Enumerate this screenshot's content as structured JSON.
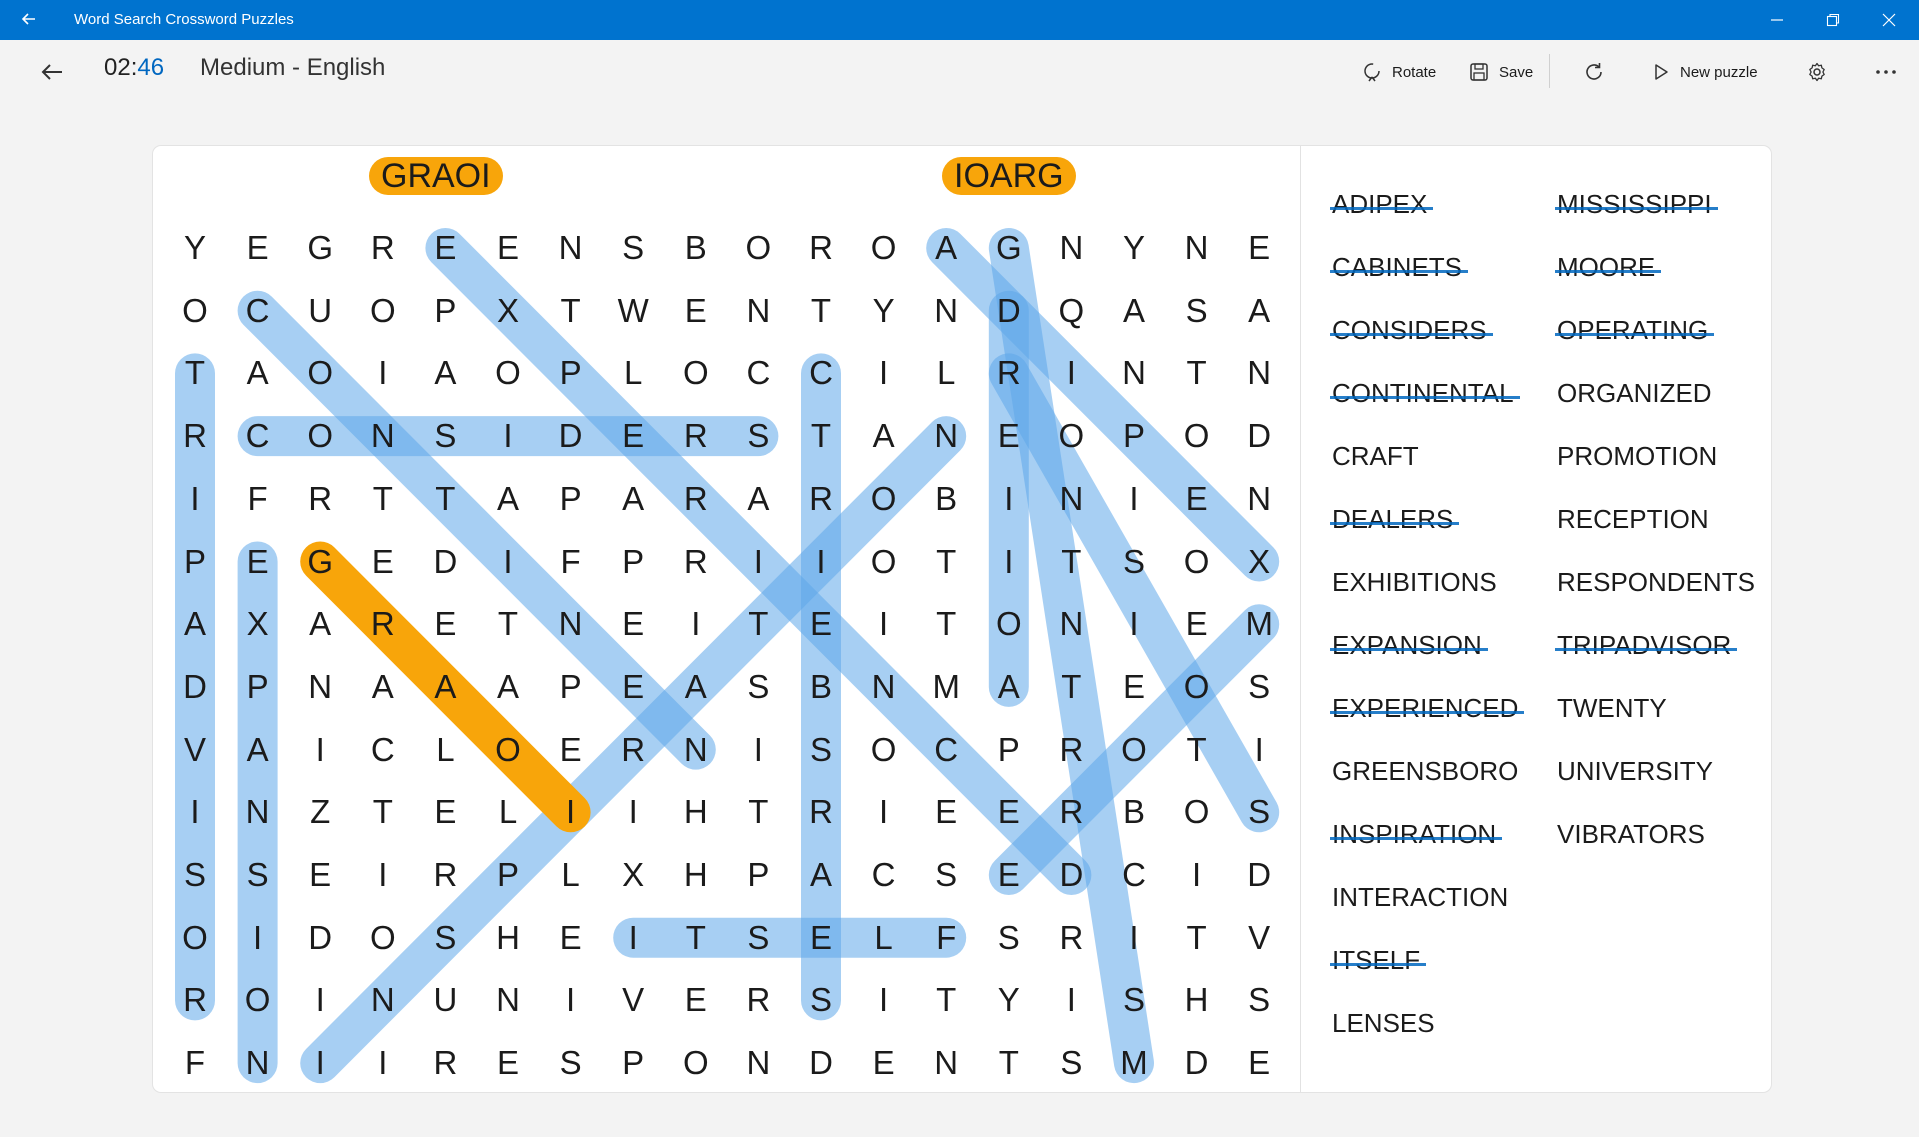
{
  "window": {
    "title": "Word Search Crossword Puzzles"
  },
  "header": {
    "timer_min": "02:",
    "timer_sec": "46",
    "puzzle_name": "Medium - English",
    "rotate_label": "Rotate",
    "save_label": "Save",
    "new_puzzle_label": "New puzzle"
  },
  "colors": {
    "titlebar": "#0073cf",
    "found_highlight": "#5ea7ea",
    "active_highlight": "#f8a50a",
    "accent": "#0067c0"
  },
  "current_selection": [
    "GRAOI",
    "IOARG"
  ],
  "grid": [
    "YEGREENSBOROAGNYNE",
    "OCUOPXTWENTYNDQASA",
    "TAOIAOPLOCCILRINTN",
    "RCONSIDERSTANEOPOD",
    "IFRTTAPARAROBINIEN",
    "PEGEDIFPRIIOTITSOX",
    "AXARETNEITEITONIEM",
    "DPNAAAPEASBNMATEOS",
    "VAICLOERNISOCPROTI",
    "INZTELIIHTRIEERBOS",
    "SSEIRPLXHPACSEDCID",
    "OIDOSHEITSELFSRITV",
    "ROINUNIVERSITYISHS",
    "FNIIRESPONDENTSMDE"
  ],
  "words": [
    {
      "text": "ADIPEX",
      "found": true
    },
    {
      "text": "CABINETS",
      "found": true
    },
    {
      "text": "CONSIDERS",
      "found": true
    },
    {
      "text": "CONTINENTAL",
      "found": true
    },
    {
      "text": "CRAFT",
      "found": false
    },
    {
      "text": "DEALERS",
      "found": true
    },
    {
      "text": "EXHIBITIONS",
      "found": false
    },
    {
      "text": "EXPANSION",
      "found": true
    },
    {
      "text": "EXPERIENCED",
      "found": true
    },
    {
      "text": "GREENSBORO",
      "found": false
    },
    {
      "text": "INSPIRATION",
      "found": true
    },
    {
      "text": "INTERACTION",
      "found": false
    },
    {
      "text": "ITSELF",
      "found": true
    },
    {
      "text": "LENSES",
      "found": false
    },
    {
      "text": "MISSISSIPPI",
      "found": true
    },
    {
      "text": "MOORE",
      "found": true
    },
    {
      "text": "OPERATING",
      "found": true
    },
    {
      "text": "ORGANIZED",
      "found": false
    },
    {
      "text": "PROMOTION",
      "found": false
    },
    {
      "text": "RECEPTION",
      "found": false
    },
    {
      "text": "RESPONDENTS",
      "found": false
    },
    {
      "text": "TRIPADVISOR",
      "found": true
    },
    {
      "text": "TWENTY",
      "found": false
    },
    {
      "text": "UNIVERSITY",
      "found": false
    },
    {
      "text": "VIBRATORS",
      "found": false
    }
  ],
  "found_paths": [
    {
      "word": "ADIPEX",
      "from": [
        0,
        12
      ],
      "to": [
        5,
        17
      ]
    },
    {
      "word": "CABINETS",
      "from": [
        1,
        1
      ],
      "to": [
        8,
        8
      ]
    },
    {
      "word": "CONSIDERS",
      "from": [
        3,
        1
      ],
      "to": [
        3,
        9
      ]
    },
    {
      "word": "CONTINENTAL",
      "from": [
        2,
        10
      ],
      "to": [
        12,
        10
      ]
    },
    {
      "word": "DEALERS",
      "from": [
        1,
        13
      ],
      "to": [
        7,
        13
      ]
    },
    {
      "word": "EXPANSION",
      "from": [
        5,
        1
      ],
      "to": [
        13,
        1
      ]
    },
    {
      "word": "EXPERIENCED",
      "from": [
        0,
        4
      ],
      "to": [
        10,
        14
      ]
    },
    {
      "word": "INSPIRATION",
      "from": [
        13,
        2
      ],
      "to": [
        3,
        12
      ]
    },
    {
      "word": "ITSELF",
      "from": [
        11,
        7
      ],
      "to": [
        11,
        12
      ]
    },
    {
      "word": "MISSISSIPPI",
      "from": [
        6,
        17
      ],
      "to": [
        10,
        13
      ]
    },
    {
      "word": "MOORE",
      "from": [
        0,
        13
      ],
      "to": [
        13,
        15
      ]
    },
    {
      "word": "OPERATING",
      "from": [
        2,
        13
      ],
      "to": [
        9,
        17
      ]
    },
    {
      "word": "TRIPADVISOR",
      "from": [
        2,
        0
      ],
      "to": [
        12,
        0
      ]
    }
  ],
  "active_path": {
    "word": "GRAOI",
    "from": [
      5,
      2
    ],
    "to": [
      9,
      6
    ]
  }
}
